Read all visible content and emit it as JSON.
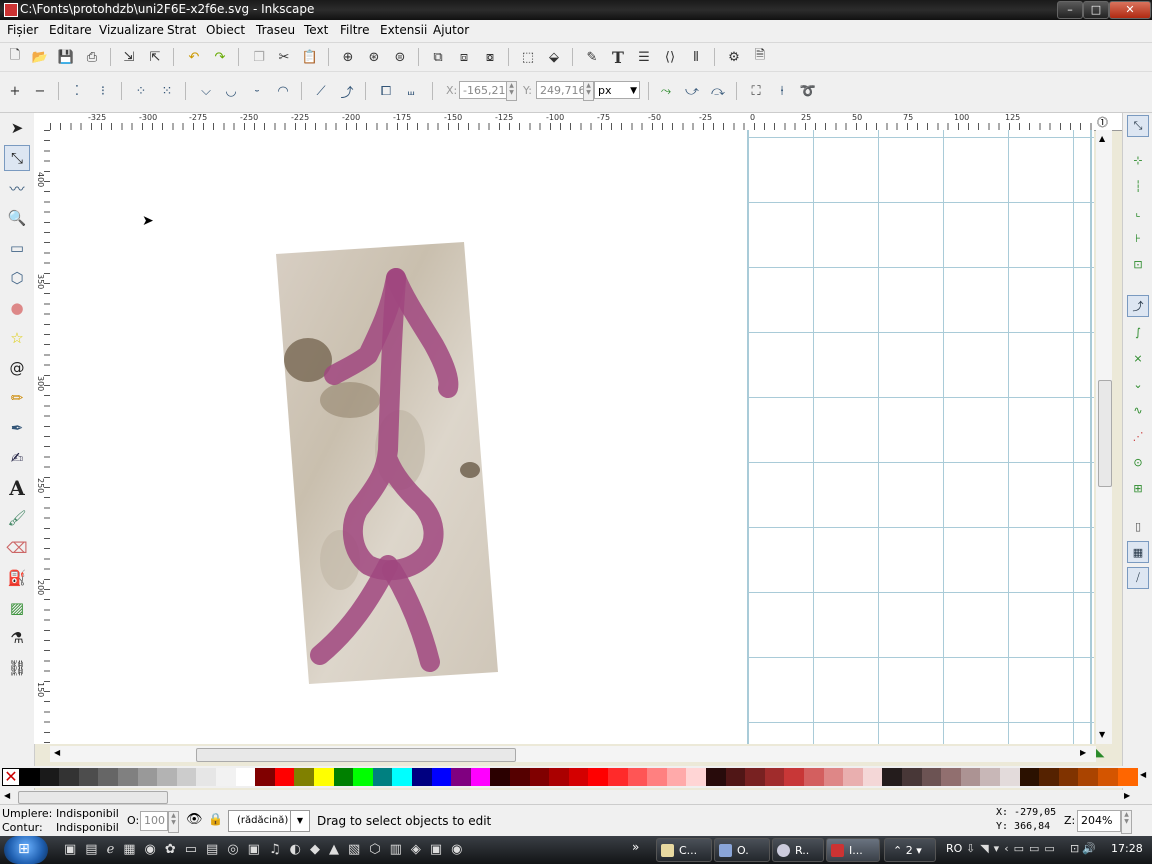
{
  "window": {
    "title": "C:\\Fonts\\protohdzb\\uni2F6E-x2f6e.svg - Inkscape",
    "minimize": "–",
    "maximize": "□",
    "close": "✕"
  },
  "menu": [
    "Fișier",
    "Editare",
    "Vizualizare",
    "Strat",
    "Obiect",
    "Traseu",
    "Text",
    "Filtre",
    "Extensii",
    "Ajutor"
  ],
  "node_toolbar": {
    "x_label": "X:",
    "x_value": "-165,21",
    "y_label": "Y:",
    "y_value": "249,716",
    "unit": "px"
  },
  "ruler": {
    "h_labels": [
      "-325",
      "-300",
      "-275",
      "-250",
      "-225",
      "-200",
      "-175",
      "-150",
      "-125",
      "-100",
      "-75",
      "-50",
      "-25",
      "0",
      "25",
      "50",
      "75",
      "100",
      "125"
    ],
    "v_labels": [
      "400",
      "350",
      "300",
      "250",
      "200",
      "150"
    ]
  },
  "palette": {
    "colors": [
      "#000000",
      "#1a1a1a",
      "#333333",
      "#4d4d4d",
      "#666666",
      "#808080",
      "#999999",
      "#b3b3b3",
      "#cccccc",
      "#e6e6e6",
      "#f2f2f2",
      "#ffffff",
      "#800000",
      "#ff0000",
      "#808000",
      "#ffff00",
      "#008000",
      "#00ff00",
      "#008080",
      "#00ffff",
      "#000080",
      "#0000ff",
      "#800080",
      "#ff00ff",
      "#2b0000",
      "#550000",
      "#800000",
      "#aa0000",
      "#d40000",
      "#ff0000",
      "#ff2a2a",
      "#ff5555",
      "#ff8080",
      "#ffaaaa",
      "#ffd5d5",
      "#280b0b",
      "#501616",
      "#782121",
      "#a02c2c",
      "#c83737",
      "#d35f5f",
      "#de8787",
      "#e9afaf",
      "#f4d7d7",
      "#241c1c",
      "#483737",
      "#6c5353",
      "#916f6f",
      "#ac9393",
      "#c8b7b7",
      "#e3dbdb",
      "#2b1100",
      "#552200",
      "#803300",
      "#aa4400",
      "#d45500",
      "#ff6600"
    ]
  },
  "status": {
    "fill_label": "Umplere:",
    "fill_value": "Indisponibil",
    "stroke_label": "Contur:",
    "stroke_value": "Indisponibil",
    "opacity_label": "O:",
    "opacity_value": "100",
    "layer": "(rădăcină)",
    "message": "Drag to select objects to edit",
    "x_coord": "X: -279,05",
    "y_coord": "Y:  366,84",
    "zoom_label": "Z:",
    "zoom_value": "204%"
  },
  "taskbar": {
    "tasks": [
      "C...",
      "O.",
      "R..",
      "I..."
    ],
    "group_count": "2",
    "lang": "RO",
    "clock": "17:28",
    "expand": "»"
  }
}
